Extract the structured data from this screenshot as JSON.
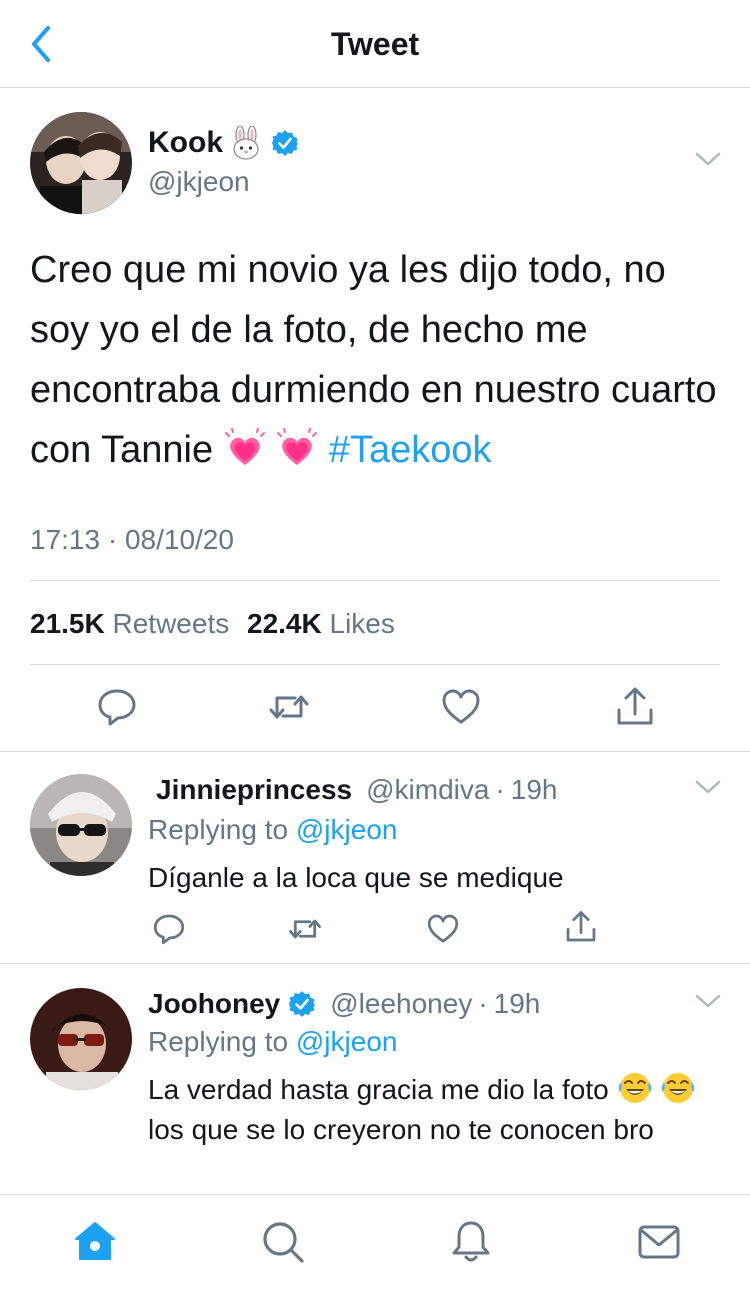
{
  "header": {
    "title": "Tweet"
  },
  "tweet": {
    "author_name": "Kook",
    "author_emoji": "rabbit-face",
    "handle": "@jkjeon",
    "text": "Creo que mi novio ya les dijo todo, no soy yo el de la foto, de hecho me encontraba durmiendo en nuestro cuarto con Tannie",
    "hashtag": "#Taekook",
    "timestamp": "17:13 · 08/10/20",
    "retweets_count": "21.5K",
    "retweets_label": "Retweets",
    "likes_count": "22.4K",
    "likes_label": "Likes"
  },
  "replies": [
    {
      "name": "Jinnieprincess",
      "handle": "@kimdiva",
      "time": "19h",
      "replying_label": "Replying to",
      "mention": "@jkjeon",
      "text": "Díganle a la loca que se medique"
    },
    {
      "name": "Joohoney",
      "handle": "@leehoney",
      "time": "19h",
      "replying_label": "Replying to",
      "mention": "@jkjeon",
      "text_a": "La verdad hasta gracia me dio la foto",
      "text_b": "los que se lo creyeron no te conocen bro"
    }
  ],
  "icons": {
    "back": "chevron-left-icon",
    "reply": "reply-icon",
    "retweet": "retweet-icon",
    "like": "heart-icon",
    "share": "share-icon",
    "home": "home-icon",
    "search": "search-icon",
    "notifications": "bell-icon",
    "messages": "mail-icon"
  },
  "colors": {
    "accent": "#1da1f2",
    "text": "#14171a",
    "muted": "#657786",
    "divider": "#d6dbdf"
  }
}
